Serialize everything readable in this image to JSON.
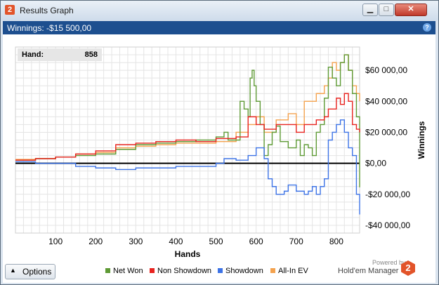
{
  "window": {
    "title": "Results Graph",
    "app_icon": "2",
    "buttons": [
      "minimize",
      "maximize",
      "close"
    ]
  },
  "header": {
    "winnings_label": "Winnings: -$15 500,00"
  },
  "hand_readout": {
    "label": "Hand:",
    "value": "858"
  },
  "options_label": "Options",
  "branding": {
    "powered": "Powered by",
    "name": "Hold'em Manager",
    "logo": "2"
  },
  "colors": {
    "net_won": "#5e9a35",
    "non_showdown": "#e8231f",
    "showdown": "#3d73e6",
    "all_in_ev": "#f4a24e",
    "title_bar": "#1d4f8f"
  },
  "chart_data": {
    "type": "line",
    "xlabel": "Hands",
    "ylabel": "Winnings",
    "xlim": [
      0,
      858
    ],
    "ylim": [
      -45000,
      75000
    ],
    "x_ticks": [
      100,
      200,
      300,
      400,
      500,
      600,
      700,
      800
    ],
    "y_ticks": [
      60000,
      40000,
      20000,
      0,
      -20000,
      -40000
    ],
    "y_tick_labels": [
      "$60 000,00",
      "$40 000,00",
      "$20 000,00",
      "$0,00",
      "-$20 000,00",
      "-$40 000,00"
    ],
    "grid": true,
    "legend": "bottom",
    "series": [
      {
        "name": "Net Won",
        "color": "#5e9a35",
        "x": [
          0,
          50,
          100,
          150,
          200,
          250,
          300,
          350,
          400,
          450,
          500,
          520,
          530,
          560,
          570,
          580,
          585,
          590,
          595,
          600,
          610,
          620,
          630,
          640,
          650,
          660,
          680,
          700,
          710,
          720,
          730,
          740,
          750,
          760,
          770,
          780,
          790,
          800,
          810,
          820,
          830,
          840,
          850,
          858
        ],
        "y": [
          2000,
          3000,
          4000,
          5000,
          6000,
          9000,
          12000,
          13000,
          14000,
          15000,
          17000,
          20000,
          15000,
          40000,
          35000,
          30000,
          55000,
          60000,
          50000,
          40000,
          25000,
          5000,
          12000,
          20000,
          24000,
          14000,
          10000,
          15000,
          5000,
          12000,
          10000,
          5000,
          20000,
          25000,
          42000,
          62000,
          55000,
          50000,
          65000,
          70000,
          60000,
          45000,
          30000,
          -15500
        ]
      },
      {
        "name": "Non Showdown",
        "color": "#e8231f",
        "x": [
          0,
          50,
          100,
          150,
          200,
          250,
          300,
          350,
          400,
          450,
          500,
          550,
          580,
          600,
          620,
          650,
          700,
          720,
          750,
          770,
          780,
          800,
          810,
          820,
          830,
          840,
          850,
          858
        ],
        "y": [
          2000,
          3000,
          4000,
          6000,
          8000,
          12000,
          13000,
          14000,
          15000,
          14000,
          16000,
          17000,
          30000,
          25000,
          22000,
          25000,
          20000,
          25000,
          28000,
          30000,
          35000,
          42000,
          38000,
          45000,
          40000,
          25000,
          22000,
          20000
        ]
      },
      {
        "name": "Showdown",
        "color": "#3d73e6",
        "x": [
          0,
          50,
          100,
          150,
          200,
          250,
          300,
          350,
          400,
          450,
          500,
          520,
          550,
          580,
          600,
          620,
          630,
          640,
          650,
          670,
          680,
          700,
          720,
          730,
          740,
          750,
          760,
          770,
          780,
          790,
          800,
          810,
          820,
          830,
          840,
          850,
          858
        ],
        "y": [
          1000,
          0,
          0,
          -2000,
          -3000,
          -4000,
          -3000,
          -3000,
          -2000,
          -2000,
          0,
          3000,
          2000,
          5000,
          10000,
          3000,
          -10000,
          -15000,
          -20000,
          -18000,
          -14000,
          -18000,
          -20000,
          -18000,
          -15000,
          -20000,
          -15000,
          -10000,
          15000,
          20000,
          25000,
          28000,
          20000,
          10000,
          5000,
          -20000,
          -33000
        ]
      },
      {
        "name": "All-In EV",
        "color": "#f4a24e",
        "x": [
          0,
          50,
          100,
          150,
          200,
          250,
          300,
          350,
          400,
          450,
          500,
          550,
          580,
          600,
          620,
          650,
          680,
          700,
          720,
          750,
          770,
          780,
          790,
          800,
          810,
          820,
          830,
          840,
          850,
          858
        ],
        "y": [
          2500,
          3000,
          4000,
          6000,
          7000,
          10000,
          11000,
          12000,
          13000,
          13000,
          14000,
          20000,
          25000,
          30000,
          20000,
          28000,
          32000,
          25000,
          40000,
          45000,
          50000,
          55000,
          65000,
          60000,
          65000,
          70000,
          60000,
          50000,
          45000,
          40000
        ]
      }
    ]
  }
}
